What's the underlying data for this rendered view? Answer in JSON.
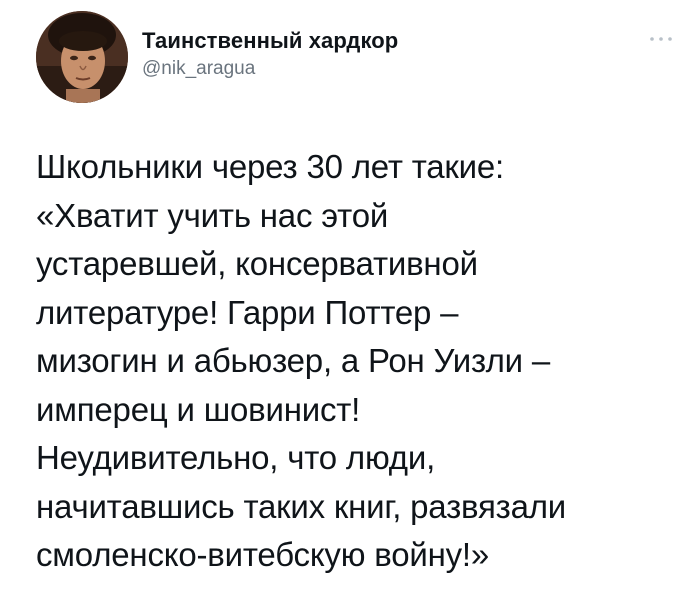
{
  "author": {
    "display_name": "Таинственный хардкор",
    "handle": "@nik_aragua",
    "avatar": "user-avatar-photo"
  },
  "more_icon": "more-horizontal-icon",
  "tweet": {
    "text": "Школьники через 30 лет такие:\n«Хватит учить нас этой\nустаревшей, консервативной\nлитературе! Гарри Поттер –\nмизогин и абьюзер, а Рон Уизли –\nимперец и шовинист!\nНеудивительно, что люди,\nначитавшись таких книг, развязали\nсмоленско-витебскую войну!»"
  },
  "colors": {
    "text": "#0f1419",
    "secondary": "#6a747e",
    "background": "#ffffff",
    "icon": "#b0b8c0"
  }
}
